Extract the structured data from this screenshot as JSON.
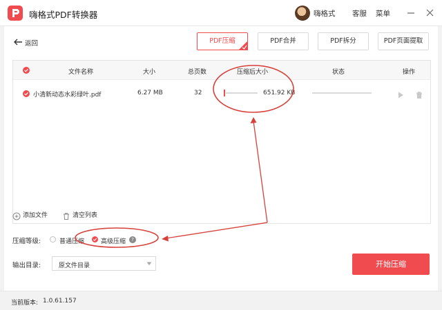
{
  "app": {
    "title": "嗨格式PDF转换器"
  },
  "user": {
    "name": "嗨格式"
  },
  "header": {
    "service": "客服",
    "menu": "菜单"
  },
  "nav": {
    "back": "返回"
  },
  "tools": [
    {
      "label": "PDF压缩"
    },
    {
      "label": "PDF合并"
    },
    {
      "label": "PDF拆分"
    },
    {
      "label": "PDF页面提取"
    }
  ],
  "table": {
    "columns": {
      "name": "文件名称",
      "size": "大小",
      "pages": "总页数",
      "compressed": "压缩后大小",
      "status": "状态",
      "actions": "操作"
    },
    "rows": [
      {
        "name": "小清新动态水彩绿叶.pdf",
        "size": "6.27 MB",
        "pages": "32",
        "compressed": "651.92 KB",
        "progress": 0.0
      }
    ]
  },
  "file_actions": {
    "add": "添加文件",
    "clear": "清空列表"
  },
  "compression": {
    "label": "压缩等级:",
    "options": [
      {
        "label": "普通压缩",
        "selected": false
      },
      {
        "label": "高级压缩",
        "selected": true
      }
    ],
    "help": "?"
  },
  "output": {
    "label": "输出目录:",
    "value": "原文件目录"
  },
  "start_button": "开始压缩",
  "footer": {
    "version_label": "当前版本:",
    "version": "1.0.61.157"
  },
  "colors": {
    "accent": "#f04b4f",
    "annotation": "#d7403a"
  },
  "icons": [
    "app-logo-icon",
    "avatar",
    "minimize-icon",
    "close-icon",
    "back-arrow-icon",
    "check-icon",
    "play-icon",
    "trash-icon",
    "plus-circle-icon",
    "trash-outline-icon",
    "chevron-down-icon",
    "help-icon"
  ]
}
